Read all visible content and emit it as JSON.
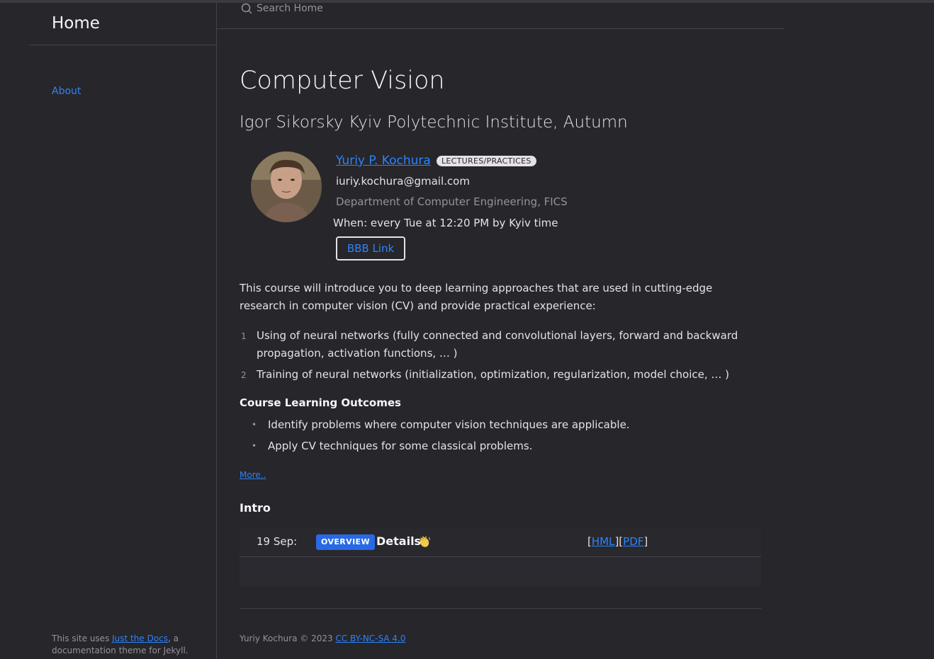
{
  "sidebar": {
    "site_title": "Home",
    "nav_items": [
      {
        "label": "About"
      }
    ],
    "footer": {
      "prefix": "This site uses ",
      "link": "Just the Docs",
      "suffix": ", a documentation theme for Jekyll."
    }
  },
  "search": {
    "placeholder": "Search Home"
  },
  "main": {
    "title": "Computer Vision",
    "subtitle": "Igor Sikorsky Kyiv Polytechnic Institute, Autumn",
    "staff": {
      "name": "Yuriy P. Kochura",
      "role": "LECTURES/PRACTICES",
      "email": "iuriy.kochura@gmail.com",
      "department": "Department of Computer Engineering, FICS",
      "when": "When: every Tue at 12:20 PM by Kyiv time",
      "button": "BBB Link"
    },
    "intro": "This course will introduce you to deep learning approaches that are used in cutting-edge research in computer vision (CV) and provide practical experience:",
    "ordered_list": [
      {
        "num": "1",
        "text": "Using of neural networks (fully connected and convolutional layers, forward and backward propagation, activation functions, … )"
      },
      {
        "num": "2",
        "text": "Training of neural networks (initialization, optimization, regularization, model choice, … )"
      }
    ],
    "outcomes_title": "Course Learning Outcomes",
    "outcomes": [
      "Identify problems where computer vision techniques are applicable.",
      "Apply CV techniques for some classical problems."
    ],
    "more_link": "More..",
    "section_heading": "Intro",
    "schedule": [
      {
        "date": "19 Sep:",
        "badge": "OVERVIEW",
        "title": "Details",
        "emoji": "waving-hand-icon",
        "link_open": "[",
        "link1": "HML",
        "link_mid": "][",
        "link2": "PDF",
        "link_close": "]"
      }
    ],
    "footer": {
      "text": "Yuriy Kochura © 2023 ",
      "license": "CC BY-NC-SA 4.0"
    }
  },
  "colors": {
    "background": "#27262b",
    "link": "#2c84fa",
    "badge": "#2869e6"
  }
}
